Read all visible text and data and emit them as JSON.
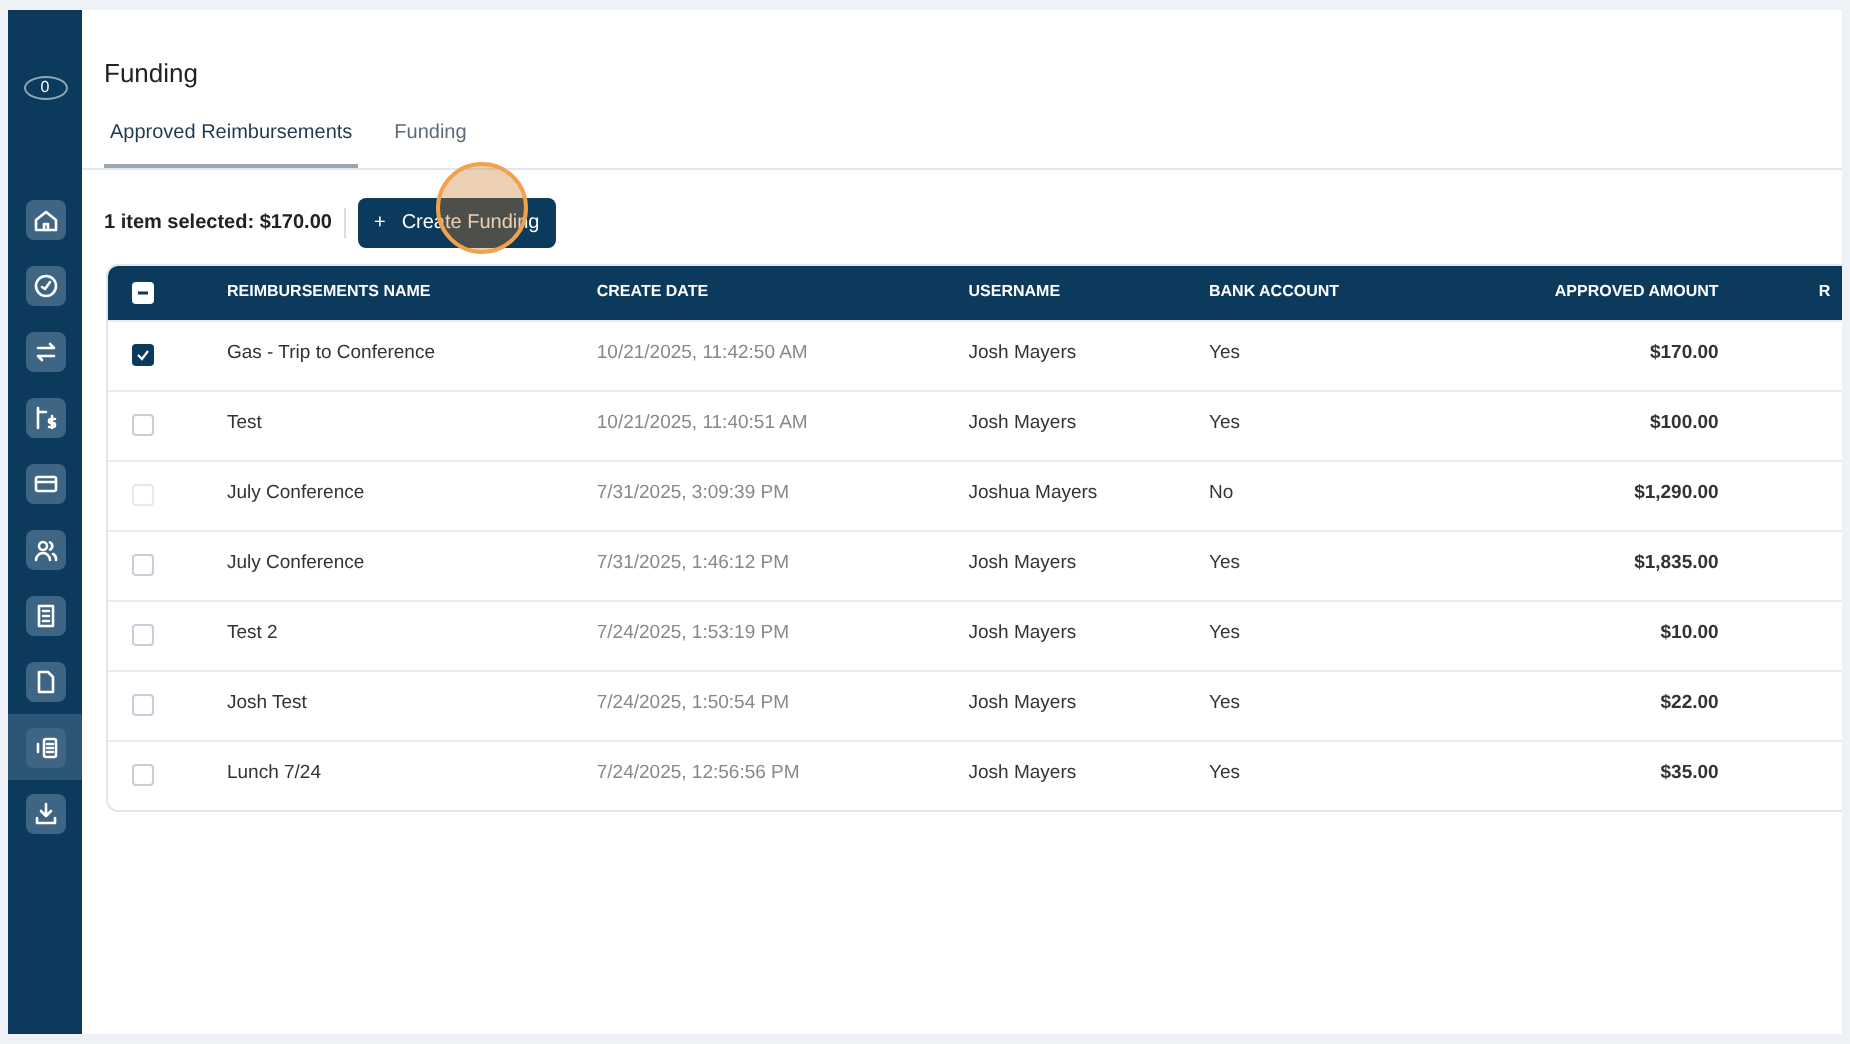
{
  "sidebar": {
    "logo": "0",
    "items": [
      {
        "selected": false
      },
      {
        "selected": false
      },
      {
        "selected": false
      },
      {
        "selected": false
      },
      {
        "selected": false
      },
      {
        "selected": false
      },
      {
        "selected": false
      },
      {
        "selected": false
      },
      {
        "selected": true
      },
      {
        "selected": false
      }
    ]
  },
  "page": {
    "title": "Funding"
  },
  "tabs": [
    {
      "label": "Approved Reimbursements",
      "selected": true
    },
    {
      "label": "Funding",
      "selected": false
    }
  ],
  "selection": {
    "summary": "1 item selected: $170.00",
    "button": {
      "icon": "+",
      "label": "Create Funding"
    }
  },
  "table": {
    "select_all_indeterminate": true,
    "columns": [
      "REIMBURSEMENTS NAME",
      "CREATE DATE",
      "USERNAME",
      "BANK ACCOUNT",
      "APPROVED AMOUNT",
      "R"
    ],
    "rows": [
      {
        "selected": true,
        "disabled": false,
        "cells": [
          "Gas - Trip to Conference",
          "10/21/2025, 11:42:50 AM",
          "Josh Mayers",
          "Yes",
          "$170.00"
        ]
      },
      {
        "selected": false,
        "disabled": false,
        "cells": [
          "Test",
          "10/21/2025, 11:40:51 AM",
          "Josh Mayers",
          "Yes",
          "$100.00"
        ]
      },
      {
        "selected": false,
        "disabled": true,
        "cells": [
          "July Conference",
          "7/31/2025, 3:09:39 PM",
          "Joshua Mayers",
          "No",
          "$1,290.00"
        ]
      },
      {
        "selected": false,
        "disabled": false,
        "cells": [
          "July Conference",
          "7/31/2025, 1:46:12 PM",
          "Josh Mayers",
          "Yes",
          "$1,835.00"
        ]
      },
      {
        "selected": false,
        "disabled": false,
        "cells": [
          "Test 2",
          "7/24/2025, 1:53:19 PM",
          "Josh Mayers",
          "Yes",
          "$10.00"
        ]
      },
      {
        "selected": false,
        "disabled": false,
        "cells": [
          "Josh Test",
          "7/24/2025, 1:50:54 PM",
          "Josh Mayers",
          "Yes",
          "$22.00"
        ]
      },
      {
        "selected": false,
        "disabled": false,
        "cells": [
          "Lunch 7/24",
          "7/24/2025, 12:56:56 PM",
          "Josh Mayers",
          "Yes",
          "$35.00"
        ]
      }
    ]
  }
}
